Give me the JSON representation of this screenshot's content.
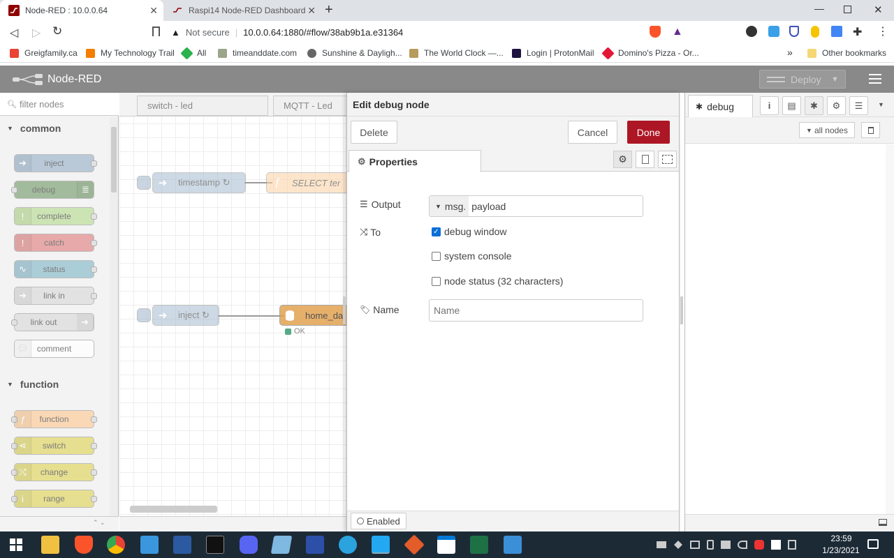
{
  "browser": {
    "tabs": [
      {
        "title": "Node-RED : 10.0.0.64",
        "active": true
      },
      {
        "title": "Raspi14 Node-RED Dashboard",
        "active": false
      }
    ],
    "new_tab": "+",
    "security": "Not secure",
    "url": "10.0.0.64:1880/#flow/38ab9b1a.e31364",
    "bookmarks": [
      "Greigfamily.ca",
      "My Technology Trail",
      "All",
      "timeanddate.com",
      "Sunshine & Dayligh...",
      "The World Clock —...",
      "Login | ProtonMail",
      "Domino's Pizza - Or..."
    ],
    "bookmarks_more": "»",
    "other_bookmarks": "Other bookmarks"
  },
  "app": {
    "title": "Node-RED",
    "deploy_label": "Deploy"
  },
  "palette": {
    "filter_placeholder": "filter nodes",
    "categories": [
      {
        "name": "common",
        "nodes": [
          "inject",
          "debug",
          "complete",
          "catch",
          "status",
          "link in",
          "link out",
          "comment"
        ]
      },
      {
        "name": "function",
        "nodes": [
          "function",
          "switch",
          "change",
          "range"
        ]
      }
    ]
  },
  "workspace": {
    "tabs": [
      "switch - led",
      "MQTT - Led"
    ],
    "nodes": [
      {
        "label": "timestamp ↻"
      },
      {
        "label": "SELECT ter"
      },
      {
        "label": "inject ↻"
      },
      {
        "label": "home_da"
      }
    ],
    "status_text": "OK"
  },
  "editor": {
    "title": "Edit debug node",
    "delete_label": "Delete",
    "cancel_label": "Cancel",
    "done_label": "Done",
    "properties_tab": "Properties",
    "output_label": "Output",
    "output_prefix": "msg.",
    "output_value": "payload",
    "to_label": "To",
    "options": [
      {
        "label": "debug window",
        "checked": true
      },
      {
        "label": "system console",
        "checked": false
      },
      {
        "label": "node status (32 characters)",
        "checked": false
      }
    ],
    "name_label": "Name",
    "name_placeholder": "Name",
    "enabled_label": "Enabled"
  },
  "sidebar": {
    "active_tab": "debug",
    "filter_label": "all nodes"
  },
  "taskbar": {
    "time": "23:59",
    "date": "1/23/2021"
  },
  "colors": {
    "done_red": "#ad1625",
    "header_gray": "#898989",
    "inject_blue": "#a6bbcf",
    "debug_green": "#87a980",
    "function_orange": "#fdd0a2",
    "catch_red": "#e49191",
    "switch_yellow": "#e2d96e",
    "storage_orange": "#e2a352"
  }
}
